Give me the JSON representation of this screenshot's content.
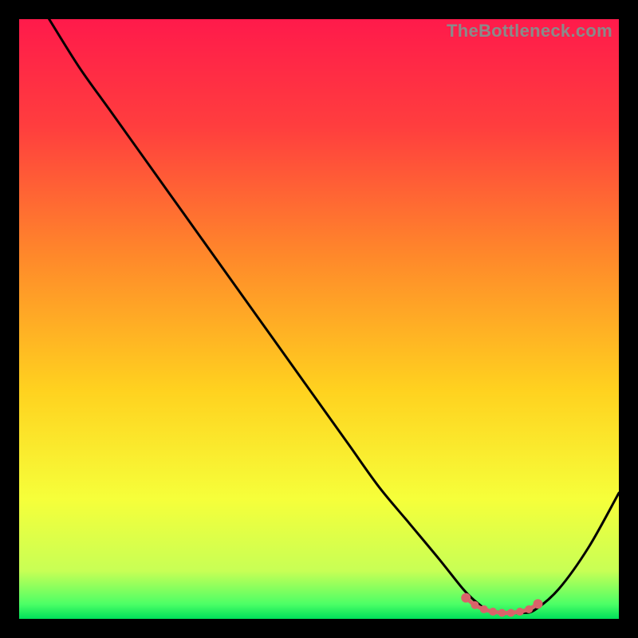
{
  "watermark": "TheBottleneck.com",
  "chart_data": {
    "type": "line",
    "title": "",
    "xlabel": "",
    "ylabel": "",
    "xlim": [
      0,
      100
    ],
    "ylim": [
      0,
      100
    ],
    "series": [
      {
        "name": "bottleneck-curve",
        "x": [
          5,
          10,
          15,
          20,
          25,
          30,
          35,
          40,
          45,
          50,
          55,
          60,
          65,
          70,
          74,
          76,
          78,
          80,
          82,
          84,
          86,
          90,
          95,
          100
        ],
        "values": [
          100,
          92,
          85,
          78,
          71,
          64,
          57,
          50,
          43,
          36,
          29,
          22,
          16,
          10,
          5,
          3,
          1.5,
          1,
          1,
          1,
          1.5,
          5,
          12,
          21
        ]
      }
    ],
    "optimal_markers": {
      "name": "optimal-range",
      "x": [
        74.5,
        76,
        77.5,
        79,
        80.5,
        82,
        83.5,
        85,
        86.5
      ],
      "values": [
        3.5,
        2.3,
        1.6,
        1.2,
        1.0,
        1.0,
        1.2,
        1.6,
        2.5
      ]
    },
    "gradient_stops": [
      {
        "offset": 0.0,
        "color": "#ff1a4b"
      },
      {
        "offset": 0.18,
        "color": "#ff3e3e"
      },
      {
        "offset": 0.4,
        "color": "#ff8a2a"
      },
      {
        "offset": 0.62,
        "color": "#ffd21f"
      },
      {
        "offset": 0.8,
        "color": "#f6ff3a"
      },
      {
        "offset": 0.92,
        "color": "#c8ff55"
      },
      {
        "offset": 0.975,
        "color": "#4dff66"
      },
      {
        "offset": 1.0,
        "color": "#00e05a"
      }
    ],
    "marker_color": "#d9636a",
    "curve_color": "#000000"
  }
}
